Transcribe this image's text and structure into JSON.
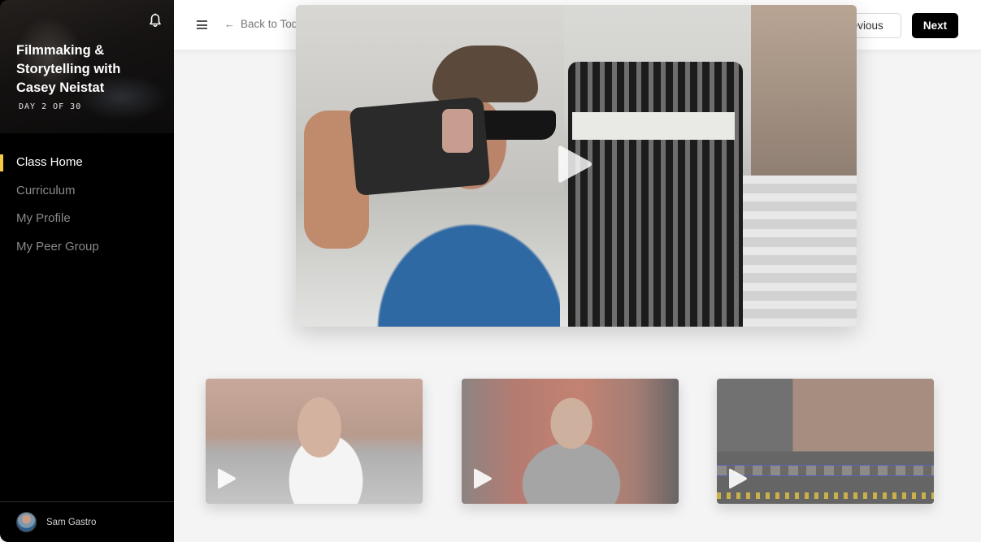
{
  "sidebar": {
    "course_title": "Filmmaking & Storytelling with Casey Neistat",
    "day_progress": "DAY 2 OF 30",
    "notifications_icon": "bell-icon",
    "nav_items": [
      {
        "label": "Class Home",
        "active": true
      },
      {
        "label": "Curriculum",
        "active": false
      },
      {
        "label": "My Profile",
        "active": false
      },
      {
        "label": "My Peer Group",
        "active": false
      }
    ],
    "user": {
      "name": "Sam Gastro"
    },
    "accent_color": "#f7c948"
  },
  "header": {
    "menu_icon": "hamburger-icon",
    "back_link": "Back to Today",
    "previous_label": "Previous",
    "next_label": "Next"
  },
  "main_video": {
    "play_icon": "play-icon"
  },
  "thumbnails": [
    {
      "play_icon": "play-icon"
    },
    {
      "play_icon": "play-icon"
    },
    {
      "play_icon": "play-icon"
    }
  ]
}
